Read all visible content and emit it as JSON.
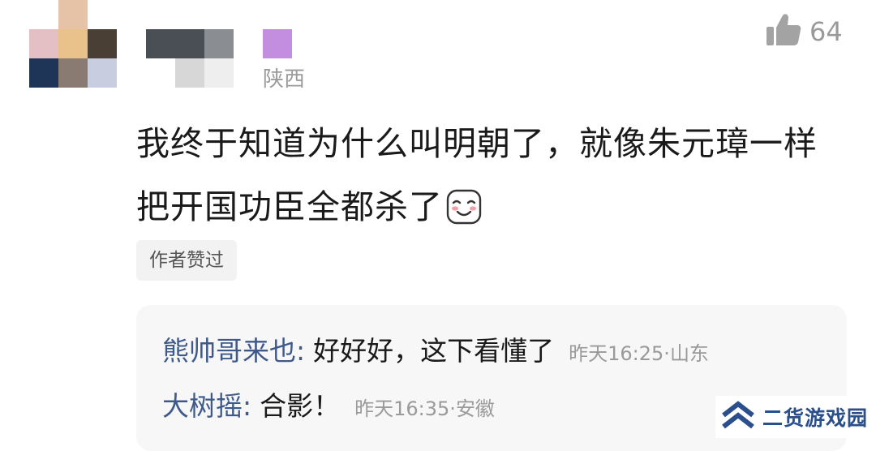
{
  "comment": {
    "location": "陕西",
    "like_count": "64",
    "content": "我终于知道为什么叫明朝了，就像朱元璋一样把开国功臣全都杀了",
    "author_badge": "作者赞过"
  },
  "replies": [
    {
      "name": "熊帅哥来也",
      "colon": ":",
      "text": "好好好，这下看懂了",
      "time": "昨天16:25",
      "sep": "·",
      "region": "山东"
    },
    {
      "name": "大树摇",
      "colon": ":",
      "text": "合影！",
      "time": "昨天16:35",
      "sep": "·",
      "region": "安徽"
    }
  ],
  "watermark": {
    "text": "二货游戏园"
  },
  "icons": {
    "like": "thumbs-up-icon",
    "emoji": "blushing-smile-emoji-icon",
    "watermark_logo": "double-chevron-up-logo-icon"
  },
  "colors": {
    "reply_name": "#3f5a8a",
    "meta": "#9a9a9a",
    "watermark": "#2b4f8c"
  }
}
